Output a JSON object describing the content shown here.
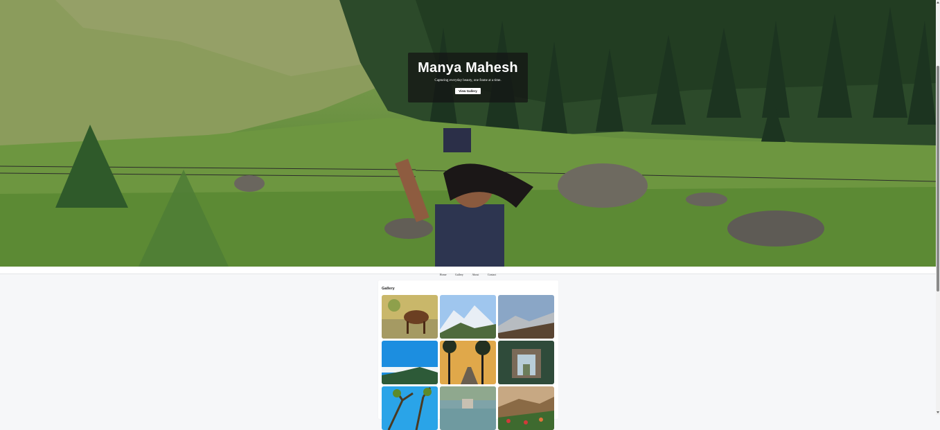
{
  "hero": {
    "title": "Manya Mahesh",
    "tagline": "Capturing everyday beauty, one frame at a time.",
    "button_label": "View Gallery"
  },
  "nav": {
    "items": [
      {
        "label": "Home"
      },
      {
        "label": "Gallery"
      },
      {
        "label": "About"
      },
      {
        "label": "Contact"
      }
    ]
  },
  "gallery": {
    "heading": "Gallery"
  },
  "colors": {
    "overlay": "#141414",
    "page_background": "#f6f7f9",
    "nav_background": "#ffffff"
  }
}
